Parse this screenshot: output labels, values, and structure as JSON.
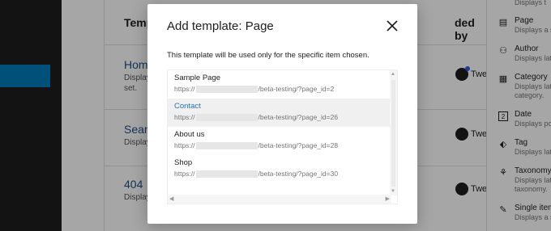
{
  "background": {
    "columns": {
      "template": "Templ",
      "added_by": "ded by"
    },
    "rows": [
      {
        "title": "Home",
        "desc_lines": [
          "Display",
          "set."
        ],
        "theme": "Twenty Twenty-T",
        "has_dot": true
      },
      {
        "title": "Search",
        "desc_lines": [
          "Display"
        ],
        "theme": "Twenty Twenty-T",
        "has_dot": false
      },
      {
        "title": "404",
        "desc_lines": [
          "Display"
        ],
        "theme": "Twenty Twenty-T",
        "has_dot": false
      }
    ]
  },
  "right_panel": {
    "items": [
      {
        "title": "",
        "desc": [
          "Displays t"
        ],
        "icon": "⚬"
      },
      {
        "title": "Page",
        "desc": [
          "Displays a si"
        ],
        "icon": "▤"
      },
      {
        "title": "Author",
        "desc": [
          "Displays late"
        ],
        "icon": "⚇"
      },
      {
        "title": "Category",
        "desc": [
          "Displays late",
          "category."
        ],
        "icon": "▦"
      },
      {
        "title": "Date",
        "desc": [
          "Displays pos"
        ],
        "icon": "2"
      },
      {
        "title": "Tag",
        "desc": [
          "Displays late"
        ],
        "icon": "⬖"
      },
      {
        "title": "Taxonomy",
        "desc": [
          "Displays late",
          "taxonomy."
        ],
        "icon": "⚘"
      },
      {
        "title": "Single item",
        "desc": [
          "Displays a si"
        ],
        "icon": "✎"
      }
    ]
  },
  "modal": {
    "title": "Add template: Page",
    "description": "This template will be used only for the specific item chosen.",
    "items": [
      {
        "title": "Sample Page",
        "url_prefix": "https://",
        "url_suffix": "/beta-testing/?page_id=2",
        "selected": false
      },
      {
        "title": "Contact",
        "url_prefix": "https://",
        "url_suffix": "/beta-testing/?page_id=26",
        "selected": true
      },
      {
        "title": "About us",
        "url_prefix": "https://",
        "url_suffix": "/beta-testing/?page_id=28",
        "selected": false
      },
      {
        "title": "Shop",
        "url_prefix": "https://",
        "url_suffix": "/beta-testing/?page_id=30",
        "selected": false
      }
    ]
  },
  "colors": {
    "accent": "#007cba",
    "link": "#2271b1",
    "dark": "#1e1e1e"
  }
}
